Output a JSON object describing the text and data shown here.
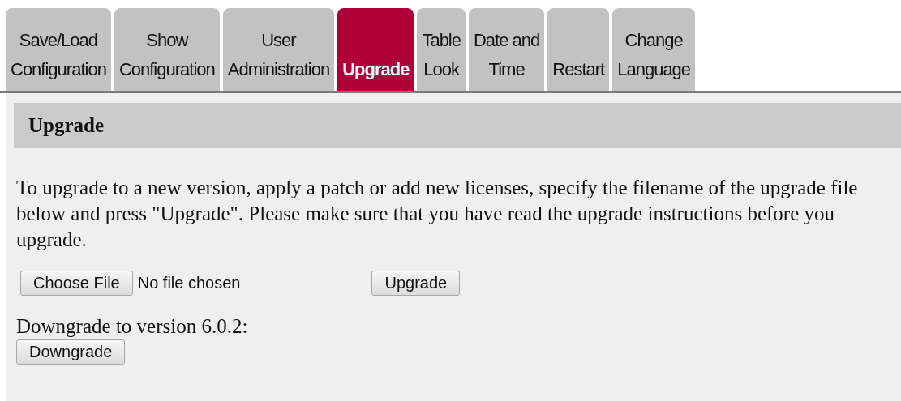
{
  "tabs": [
    {
      "label": "Save/Load\nConfiguration",
      "selected": false
    },
    {
      "label": "Show\nConfiguration",
      "selected": false
    },
    {
      "label": "User\nAdministration",
      "selected": false
    },
    {
      "label": "Upgrade",
      "selected": true
    },
    {
      "label": "Table\nLook",
      "selected": false
    },
    {
      "label": "Date and\nTime",
      "selected": false
    },
    {
      "label": "Restart",
      "selected": false
    },
    {
      "label": "Change\nLanguage",
      "selected": false
    }
  ],
  "section": {
    "title": "Upgrade",
    "description": "To upgrade to a new version, apply a patch or add new licenses, specify the filename of the upgrade file below and press \"Upgrade\". Please make sure that you have read the upgrade instructions before you upgrade.",
    "file_picker": {
      "button": "Choose File",
      "status": "No file chosen"
    },
    "upgrade_button": "Upgrade",
    "downgrade_label": "Downgrade to version 6.0.2:",
    "downgrade_button": "Downgrade"
  }
}
